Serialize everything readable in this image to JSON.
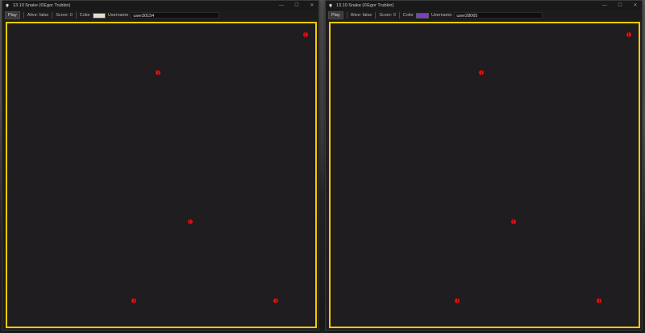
{
  "windows": [
    {
      "title": "13.10 Snake (©Egor Trubkin)",
      "play_label": "Play",
      "alive_text": "Alive: false",
      "score_text": "Score: 0",
      "color_label": "Color",
      "color_value": "#e4dccf",
      "username_label": "Username",
      "username_value": "user30154",
      "board_border_color": "#f2cc00",
      "food_color": "#e01010",
      "food_positions": [
        [
          0.968,
          0.038
        ],
        [
          0.49,
          0.163
        ],
        [
          0.593,
          0.653
        ],
        [
          0.412,
          0.914
        ],
        [
          0.873,
          0.914
        ]
      ]
    },
    {
      "title": "13.10 Snake (©Egor Trubkin)",
      "play_label": "Play",
      "alive_text": "Alive: false",
      "score_text": "Score: 0",
      "color_label": "Color",
      "color_value": "#7b3fc4",
      "username_label": "Username",
      "username_value": "user28065",
      "board_border_color": "#f2cc00",
      "food_color": "#e01010",
      "food_positions": [
        [
          0.968,
          0.038
        ],
        [
          0.49,
          0.163
        ],
        [
          0.593,
          0.653
        ],
        [
          0.412,
          0.914
        ],
        [
          0.873,
          0.914
        ]
      ]
    }
  ],
  "window_controls": {
    "minimize": "—",
    "maximize": "☐",
    "close": "✕"
  }
}
